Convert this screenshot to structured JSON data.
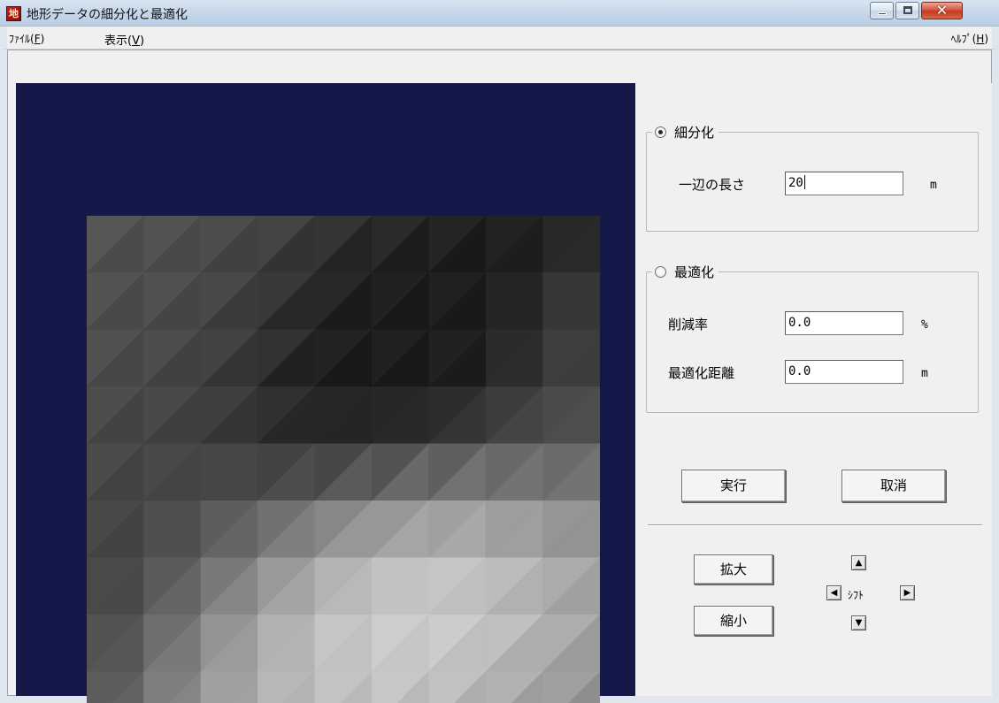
{
  "window": {
    "title": "地形データの細分化と最適化",
    "icon_glyph": "地",
    "close_glyph": "✕"
  },
  "menu": {
    "file": {
      "label": "ﾌｧｲﾙ(",
      "key": "F",
      "suffix": ")"
    },
    "view": {
      "label": "表示(",
      "key": "V",
      "suffix": ")"
    },
    "help": {
      "label": "ﾍﾙﾌﾟ(",
      "key": "H",
      "suffix": ")"
    }
  },
  "subdivision": {
    "label": "細分化",
    "selected": true,
    "edge_length_label": "一辺の長さ",
    "edge_length_value": "20",
    "edge_length_unit": "m"
  },
  "optimization": {
    "label": "最適化",
    "selected": false,
    "reduction_label": "削減率",
    "reduction_value": "0.0",
    "reduction_unit": "%",
    "distance_label": "最適化距離",
    "distance_value": "0.0",
    "distance_unit": "m"
  },
  "buttons": {
    "run": "実行",
    "cancel": "取消",
    "zoom_in": "拡大",
    "zoom_out": "縮小"
  },
  "shift": {
    "label": "ｼﾌﾄ",
    "up": "▲",
    "down": "▼",
    "left": "◀",
    "right": "▶"
  },
  "colors": {
    "viewport_background": "#15194a",
    "panel_background": "#f0f0f0"
  },
  "terrain": {
    "grid_columns": 9,
    "grid_rows": 9,
    "cell_gray_levels": [
      [
        86,
        80,
        76,
        70,
        60,
        45,
        36,
        32,
        30,
        38
      ],
      [
        80,
        78,
        74,
        62,
        42,
        32,
        28,
        28,
        40,
        60
      ],
      [
        78,
        76,
        70,
        56,
        34,
        28,
        28,
        30,
        52,
        66
      ],
      [
        76,
        72,
        64,
        48,
        30,
        28,
        28,
        36,
        58,
        70
      ],
      [
        72,
        70,
        66,
        54,
        46,
        48,
        60,
        76,
        84,
        92
      ],
      [
        70,
        72,
        78,
        90,
        108,
        126,
        138,
        140,
        134,
        130
      ],
      [
        66,
        74,
        98,
        128,
        158,
        180,
        190,
        186,
        170,
        154
      ],
      [
        70,
        88,
        126,
        160,
        186,
        200,
        204,
        196,
        178,
        160
      ],
      [
        78,
        104,
        144,
        174,
        192,
        200,
        200,
        188,
        168,
        150
      ],
      [
        86,
        118,
        150,
        172,
        184,
        186,
        180,
        166,
        150,
        138
      ]
    ]
  }
}
